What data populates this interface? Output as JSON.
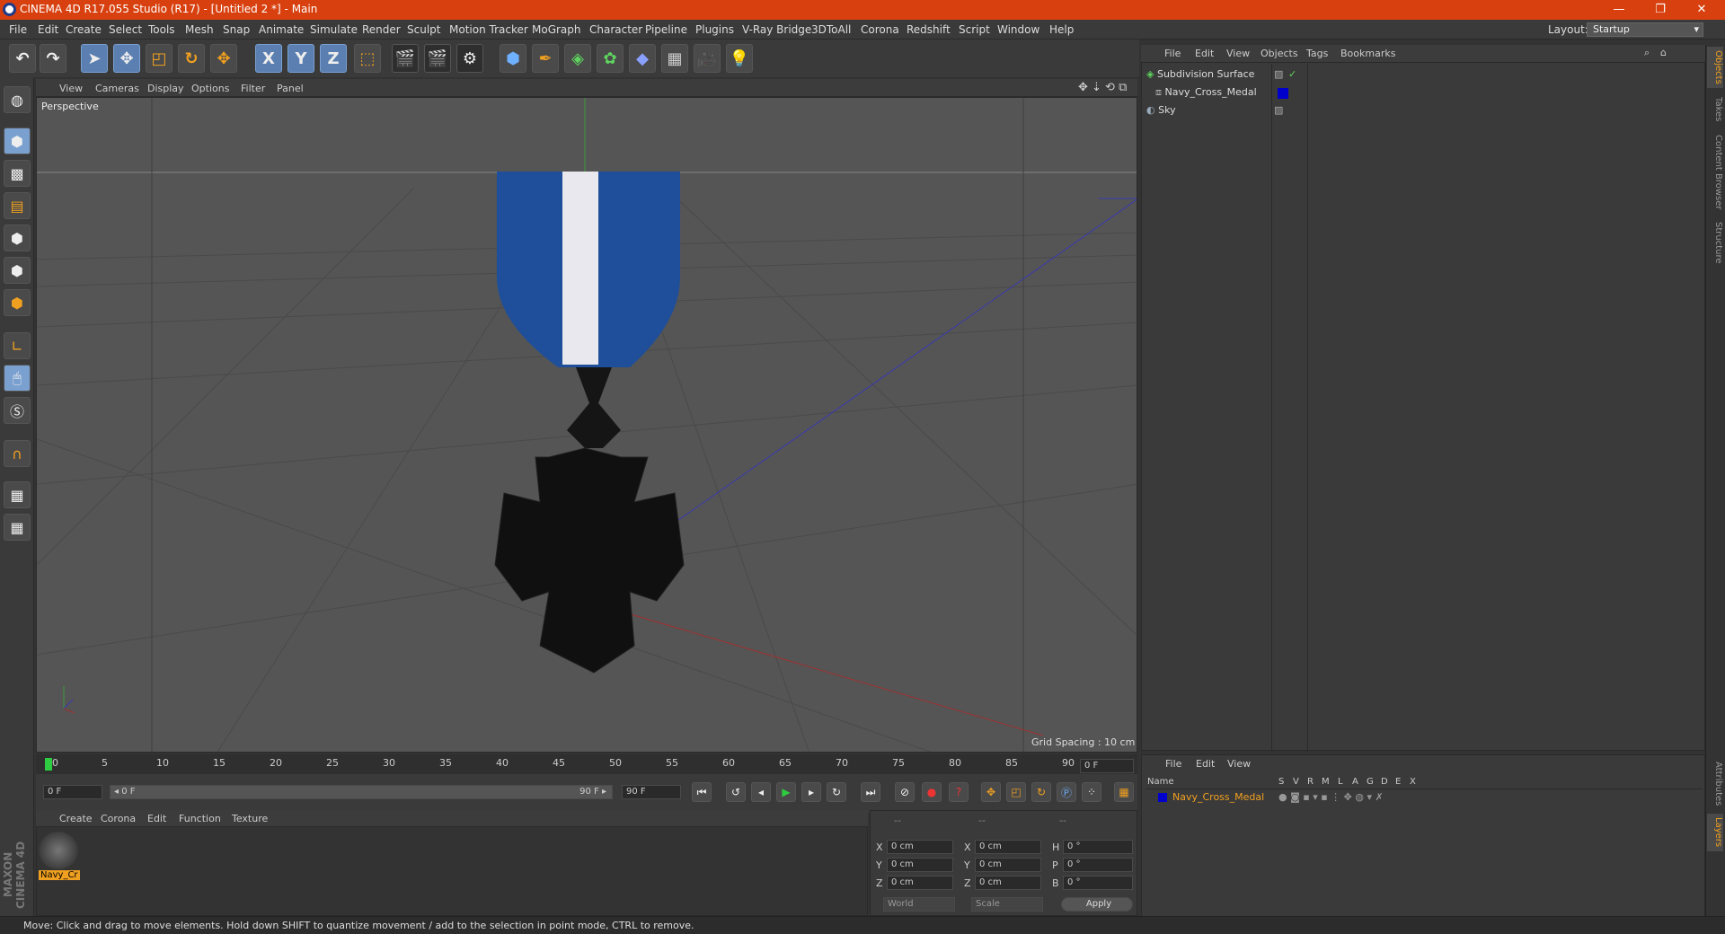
{
  "app": {
    "title": "CINEMA 4D R17.055 Studio (R17) - [Untitled 2 *] - Main",
    "layout_label": "Layout:",
    "layout_value": "Startup"
  },
  "window_controls": {
    "minimize": "—",
    "restore": "❐",
    "close": "✕"
  },
  "menu": [
    "File",
    "Edit",
    "Create",
    "Select",
    "Tools",
    "Mesh",
    "Snap",
    "Animate",
    "Simulate",
    "Render",
    "Sculpt",
    "Motion Tracker",
    "MoGraph",
    "Character",
    "Pipeline",
    "Plugins",
    "V-Ray Bridge",
    "3DToAll",
    "Corona",
    "Redshift",
    "Script",
    "Window",
    "Help"
  ],
  "toolbar": {
    "icons": [
      "undo-icon",
      "redo-icon",
      "select-icon",
      "move-icon",
      "scale-icon",
      "rotate-icon",
      "recent-tool-icon",
      "x-axis-icon",
      "y-axis-icon",
      "z-axis-icon",
      "coord-system-icon",
      "render-view-icon",
      "render-picture-viewer-icon",
      "edit-render-settings-icon",
      "cube-icon",
      "pen-icon",
      "subdivision-icon",
      "cloner-icon",
      "deformer-icon",
      "floor-icon",
      "camera-icon",
      "light-icon"
    ],
    "axis_x": "X",
    "axis_y": "Y",
    "axis_z": "Z"
  },
  "left_tools": [
    "make-editable-icon",
    "model-mode-icon",
    "texture-mode-icon",
    "workplane-icon",
    "points-mode-icon",
    "edges-mode-icon",
    "polygons-mode-icon",
    "axis-mode-icon",
    "tweak-icon",
    "solo-icon",
    "magnet-icon",
    "snap-grid-icon",
    "snap-icon"
  ],
  "viewport": {
    "menus": [
      "View",
      "Cameras",
      "Display",
      "Options",
      "Filter",
      "Panel"
    ],
    "label": "Perspective",
    "grid_spacing": "Grid Spacing : 10 cm"
  },
  "timeline": {
    "ticks": [
      "0",
      "5",
      "10",
      "15",
      "20",
      "25",
      "30",
      "35",
      "40",
      "45",
      "50",
      "55",
      "60",
      "65",
      "70",
      "75",
      "80",
      "85",
      "90"
    ],
    "current_frame": "0 F",
    "start": "0 F",
    "range_start": "◂ 0 F",
    "range_end": "90 F ▸",
    "end": "90 F",
    "end_field": "0 F"
  },
  "material_manager": {
    "menus": [
      "Create",
      "Corona",
      "Edit",
      "Function",
      "Texture"
    ],
    "material_name": "Navy_Cr"
  },
  "coordinates": {
    "header": [
      "--",
      "--",
      "--"
    ],
    "rows": [
      {
        "a": "X",
        "av": "0 cm",
        "b": "X",
        "bv": "0 cm",
        "c": "H",
        "cv": "0 °"
      },
      {
        "a": "Y",
        "av": "0 cm",
        "b": "Y",
        "bv": "0 cm",
        "c": "P",
        "cv": "0 °"
      },
      {
        "a": "Z",
        "av": "0 cm",
        "b": "Z",
        "bv": "0 cm",
        "c": "B",
        "cv": "0 °"
      }
    ],
    "world": "World",
    "scale": "Scale",
    "apply": "Apply"
  },
  "object_manager": {
    "menus": [
      "File",
      "Edit",
      "View",
      "Objects",
      "Tags",
      "Bookmarks"
    ],
    "objects": [
      "Subdivision Surface",
      "Navy_Cross_Medal",
      "Sky"
    ]
  },
  "layer_manager": {
    "menus": [
      "File",
      "Edit",
      "View"
    ],
    "columns": [
      "Name",
      "S",
      "V",
      "R",
      "M",
      "L",
      "A",
      "G",
      "D",
      "E",
      "X"
    ],
    "layer": "Navy_Cross_Medal"
  },
  "right_tabs": [
    "Objects",
    "Takes",
    "Content Browser",
    "Structure",
    "Attributes",
    "Layers"
  ],
  "brand": "MAXON CINEMA 4D",
  "status": "Move: Click and drag to move elements. Hold down SHIFT to quantize movement / add to the selection in point mode, CTRL to remove.",
  "colors": {
    "titlebar": "#d8410f",
    "accent_blue": "#1f5fbf",
    "medal_ribbon": "#1f4f9a",
    "layer_color": "#0000cc"
  }
}
